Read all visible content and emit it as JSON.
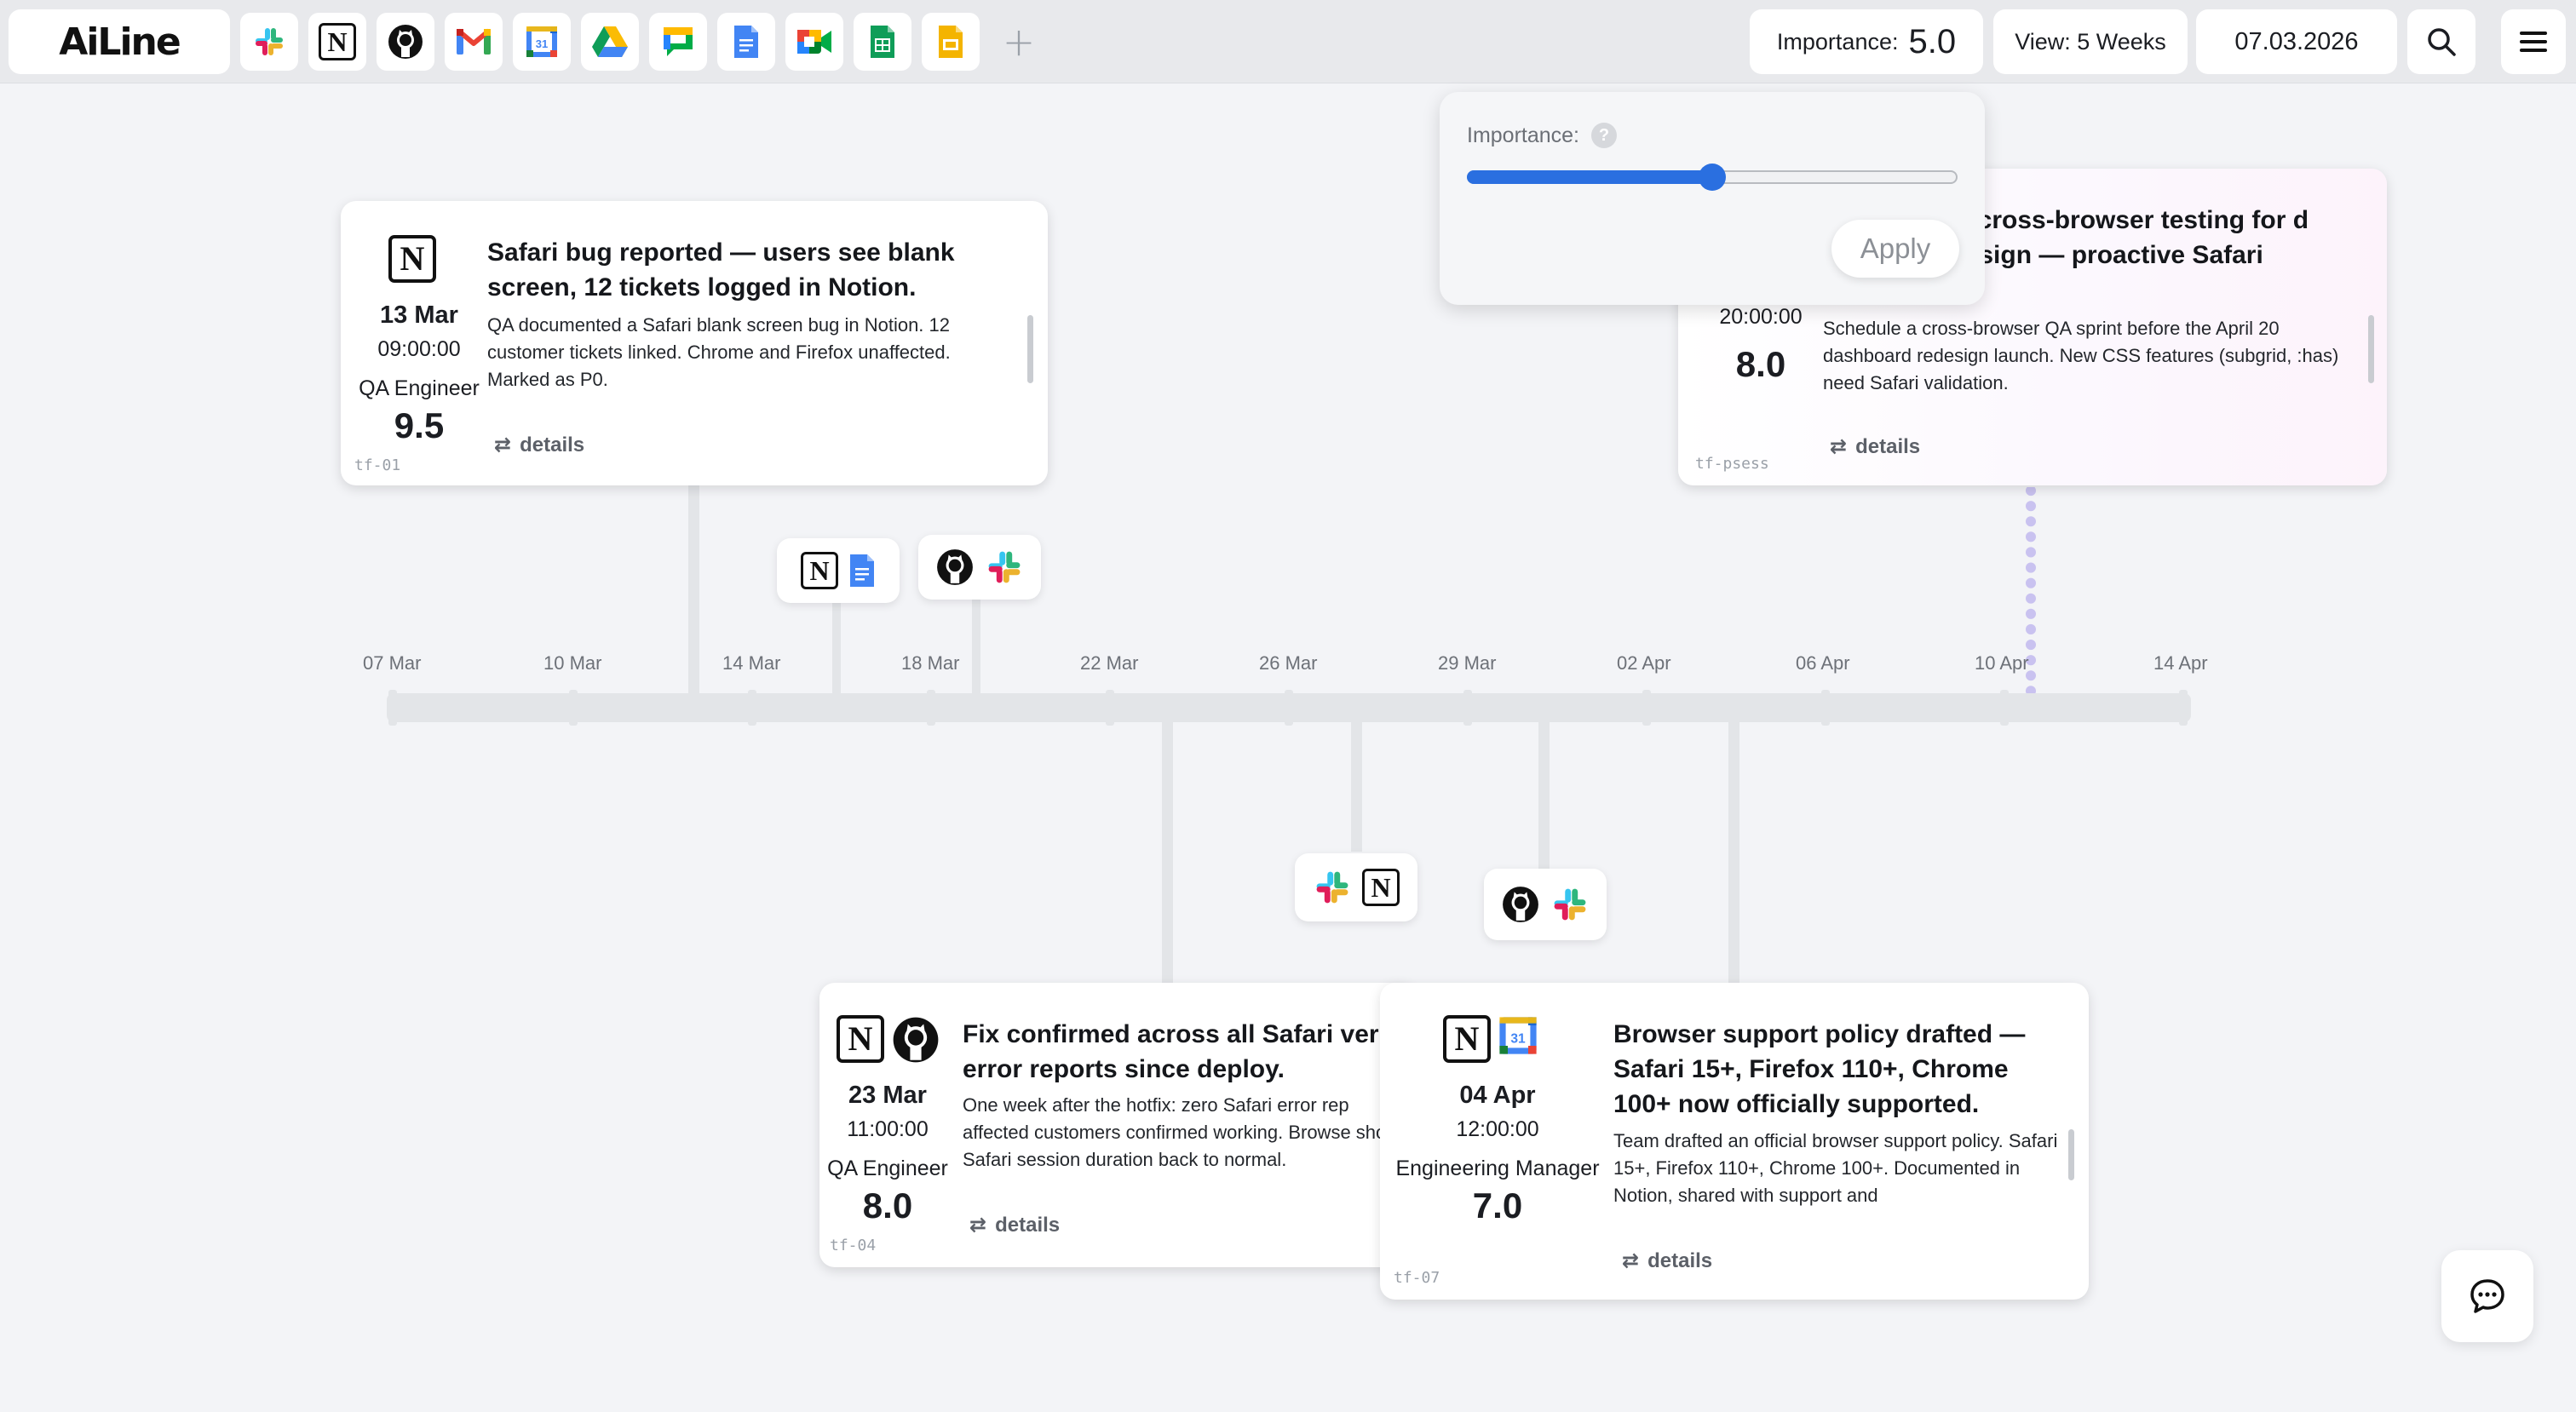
{
  "app": {
    "logo": "AiLine",
    "add_label": "+"
  },
  "toolbar_apps": [
    "slack-icon",
    "notion-icon",
    "github-icon",
    "gmail-icon",
    "google-calendar-icon",
    "google-drive-icon",
    "google-chat-icon",
    "google-docs-icon",
    "google-meet-icon",
    "google-sheets-icon",
    "google-slides-icon"
  ],
  "header": {
    "importance_label": "Importance:",
    "importance_value": "5.0",
    "view_label": "View: 5 Weeks",
    "date": "07.03.2026"
  },
  "popover": {
    "label": "Importance:",
    "help": "?",
    "slider_value": 0.5,
    "apply_label": "Apply"
  },
  "timeline": {
    "ticks": [
      "07 Mar",
      "10 Mar",
      "14 Mar",
      "18 Mar",
      "22 Mar",
      "26 Mar",
      "29 Mar",
      "02 Apr",
      "06 Apr",
      "10 Apr",
      "14 Apr"
    ]
  },
  "cards": [
    {
      "id": "tf-01",
      "icons": [
        "notion-icon"
      ],
      "date": "13 Mar",
      "time": "09:00:00",
      "role": "QA Engineer",
      "score": "9.5",
      "title": "Safari bug reported — users see blank screen, 12 tickets logged in Notion.",
      "description": "QA documented a Safari blank screen bug in Notion. 12 customer tickets linked. Chrome and Firefox unaffected. Marked as P0.",
      "details_label": "details"
    },
    {
      "id": "tf-psess",
      "icons": [],
      "date": "",
      "time": "20:00:00",
      "role": "",
      "score": "8.0",
      "title": "and cross-browser testing for d redesign — proactive Safari",
      "description": "Schedule a cross-browser QA sprint before the April 20 dashboard redesign launch. New CSS features (subgrid, :has) need Safari validation.",
      "details_label": "details"
    },
    {
      "id": "tf-04",
      "icons": [
        "notion-icon",
        "github-icon"
      ],
      "date": "23 Mar",
      "time": "11:00:00",
      "role": "QA Engineer",
      "score": "8.0",
      "title": "Fix confirmed across all Safari ver error reports since deploy.",
      "description": "One week after the hotfix: zero Safari error rep affected customers confirmed working. Browse show Safari session duration back to normal.",
      "details_label": "details"
    },
    {
      "id": "tf-07",
      "icons": [
        "notion-icon",
        "google-calendar-icon"
      ],
      "date": "04 Apr",
      "time": "12:00:00",
      "role": "Engineering Manager",
      "score": "7.0",
      "title": "Browser support policy drafted — Safari 15+, Firefox 110+, Chrome 100+ now officially supported.",
      "description": "Team drafted an official browser support policy. Safari 15+, Firefox 110+, Chrome 100+. Documented in Notion, shared with support and",
      "details_label": "details"
    }
  ],
  "clusters": [
    {
      "icons": [
        "notion-icon",
        "google-docs-icon"
      ]
    },
    {
      "icons": [
        "github-icon",
        "slack-icon"
      ]
    },
    {
      "icons": [
        "slack-icon",
        "notion-icon"
      ]
    },
    {
      "icons": [
        "github-icon",
        "slack-icon"
      ]
    }
  ],
  "colors": {
    "accent": "#2a6fe0",
    "timeline": "#e3e5e8",
    "dotted": "#c9c2f0"
  }
}
